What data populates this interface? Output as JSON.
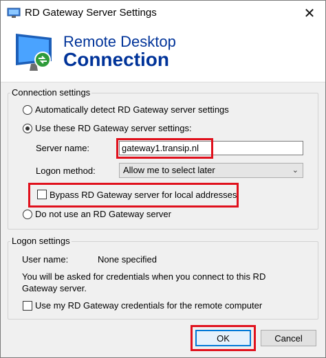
{
  "window": {
    "title": "RD Gateway Server Settings",
    "close_glyph": "✕"
  },
  "banner": {
    "line1": "Remote Desktop",
    "line2": "Connection"
  },
  "connection_settings": {
    "legend": "Connection settings",
    "auto_detect": {
      "label": "Automatically detect RD Gateway server settings",
      "checked": false
    },
    "use_these": {
      "label": "Use these RD Gateway server settings:",
      "checked": true
    },
    "server_name": {
      "label": "Server name:",
      "value": "gateway1.transip.nl"
    },
    "logon_method": {
      "label": "Logon method:",
      "value": "Allow me to select later"
    },
    "bypass": {
      "label": "Bypass RD Gateway server for local addresses",
      "checked": false
    },
    "do_not_use": {
      "label": "Do not use an RD Gateway server",
      "checked": false
    }
  },
  "logon_settings": {
    "legend": "Logon settings",
    "user_name_label": "User name:",
    "user_name_value": "None specified",
    "info_line1": "You will be asked for credentials when you connect to this RD",
    "info_line2": "Gateway server.",
    "use_credentials": {
      "label": "Use my RD Gateway credentials for the remote computer",
      "checked": false
    }
  },
  "buttons": {
    "ok": "OK",
    "cancel": "Cancel"
  },
  "colors": {
    "accent": "#003399",
    "highlight": "#e0101c",
    "focus": "#0078d7"
  }
}
